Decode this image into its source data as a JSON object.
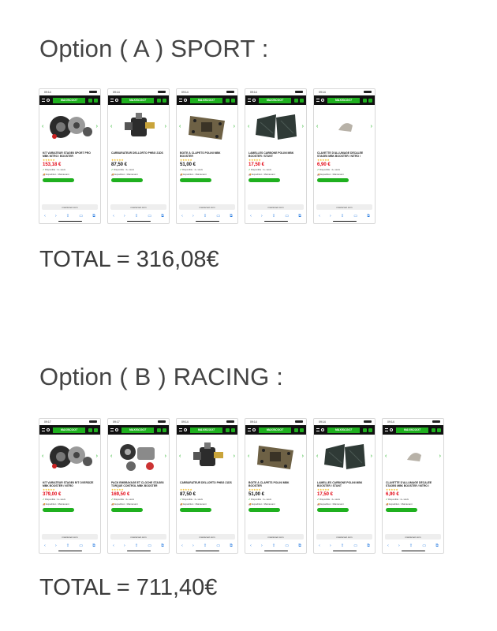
{
  "option_a": {
    "heading": "Option ( A ) SPORT :",
    "total": "TOTAL = 316,08€",
    "screens": [
      {
        "time": "09:14",
        "title": "KIT VARIATEUR STAGE6 SPORT PRO MBK NITRO / BOOSTER",
        "price": "153,18 €",
        "price_red": true,
        "img": "variator"
      },
      {
        "time": "09:14",
        "title": "CARBURATEUR DELLORTO PHBG 21DS",
        "price": "87,50 €",
        "price_red": false,
        "img": "carb"
      },
      {
        "time": "09:14",
        "title": "BOITE À CLAPETS POLINI MBK BOOSTER",
        "price": "51,00 €",
        "price_red": false,
        "img": "reedbox"
      },
      {
        "time": "09:14",
        "title": "LAMELLES CARBONE POLINI MBK BOOSTER / STUNT",
        "price": "17,50 €",
        "price_red": true,
        "img": "petals"
      },
      {
        "time": "09:14",
        "title": "CLAVETTE D'ALLUMAGE DÉCALÉE STAGE6 MBK BOOSTER / NITRO / OVETTO",
        "price": "6,90 €",
        "price_red": true,
        "img": "key"
      }
    ]
  },
  "option_b": {
    "heading": "Option ( B ) RACING :",
    "total": "TOTAL = 711,40€",
    "screens": [
      {
        "time": "09:17",
        "title": "KIT VARIATEUR STAGE6 R/T OVERSIZE MBK BOOSTER / NITRO",
        "price": "379,00 €",
        "price_red": true,
        "img": "variator"
      },
      {
        "time": "09:17",
        "title": "PACK EMBRAYAGE ET CLOCHE STAGE6 TORQUE CONTROL MBK BOOSTER",
        "price": "169,50 €",
        "price_red": true,
        "img": "clutch"
      },
      {
        "time": "09:14",
        "title": "CARBURATEUR DELLORTO PHBG 21DS",
        "price": "87,50 €",
        "price_red": false,
        "img": "carb"
      },
      {
        "time": "09:14",
        "title": "BOITE À CLAPETS POLINI MBK BOOSTER",
        "price": "51,00 €",
        "price_red": false,
        "img": "reedbox"
      },
      {
        "time": "09:14",
        "title": "LAMELLES CARBONE POLINI MBK BOOSTER / STUNT",
        "price": "17,50 €",
        "price_red": true,
        "img": "petals"
      },
      {
        "time": "09:14",
        "title": "CLAVETTE D'ALLUMAGE DÉCALÉE STAGE6 MBK BOOSTER / NITRO / OVETTO",
        "price": "6,90 €",
        "price_red": true,
        "img": "key"
      }
    ]
  },
  "common": {
    "logo": "MAXISCOOT",
    "url": "maxiscoot.com",
    "stock": "Disponible : 2+ stock",
    "shipping": "Expédition : Maintenant"
  }
}
